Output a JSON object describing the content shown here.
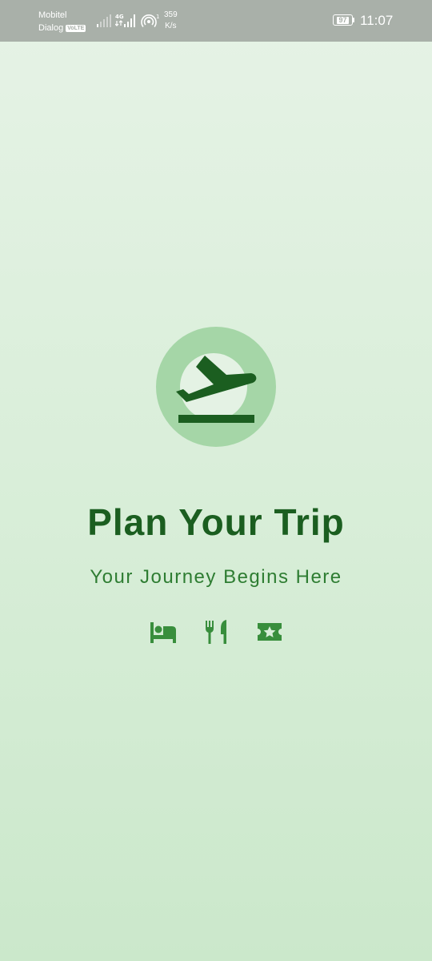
{
  "status_bar": {
    "carrier_1": "Mobitel",
    "carrier_2": "Dialog",
    "volte": "VoLTE",
    "network_type": "4G",
    "speed_value": "359",
    "speed_unit": "K/s",
    "battery_level": "97",
    "time": "11:07",
    "icons": [
      "signal-weak-icon",
      "signal-4g-icon",
      "hotspot-icon",
      "battery-icon"
    ]
  },
  "splash": {
    "logo_icon": "flight-takeoff-icon",
    "title": "Plan Your Trip",
    "subtitle": "Your Journey Begins Here",
    "feature_icons": [
      "hotel-bed-icon",
      "restaurant-icon",
      "attraction-ticket-icon"
    ]
  },
  "colors": {
    "status_bar_bg": "#a9b0a9",
    "background_top": "#e6f3e6",
    "background_bottom": "#cbe8cb",
    "logo_circle": "#a5d6a7",
    "primary_dark": "#1b5e20",
    "primary": "#2e7d32",
    "icon_green": "#388e3c"
  }
}
